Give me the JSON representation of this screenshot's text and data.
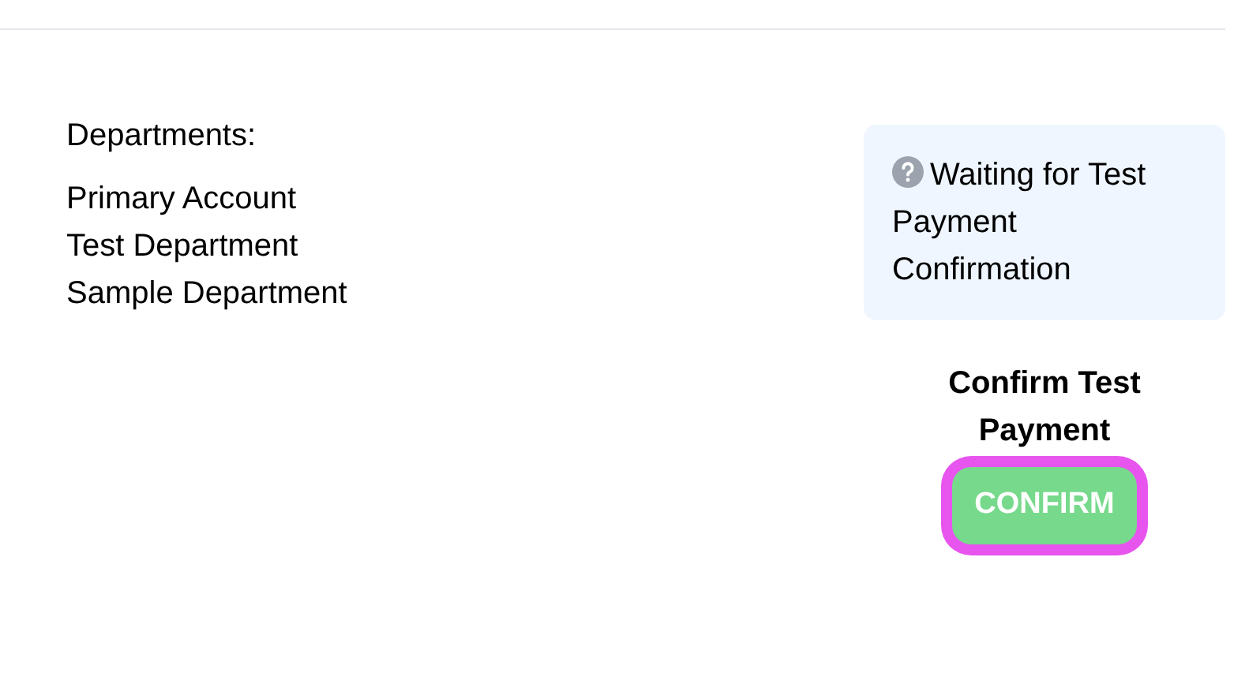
{
  "departments": {
    "label": "Departments:",
    "items": [
      "Primary Account",
      "Test Department",
      "Sample Department"
    ]
  },
  "status": {
    "message": "Waiting for Test Payment Confirmation"
  },
  "confirm": {
    "heading": "Confirm Test Payment",
    "button": {
      "label": "CONFIRM",
      "focused": true
    }
  }
}
